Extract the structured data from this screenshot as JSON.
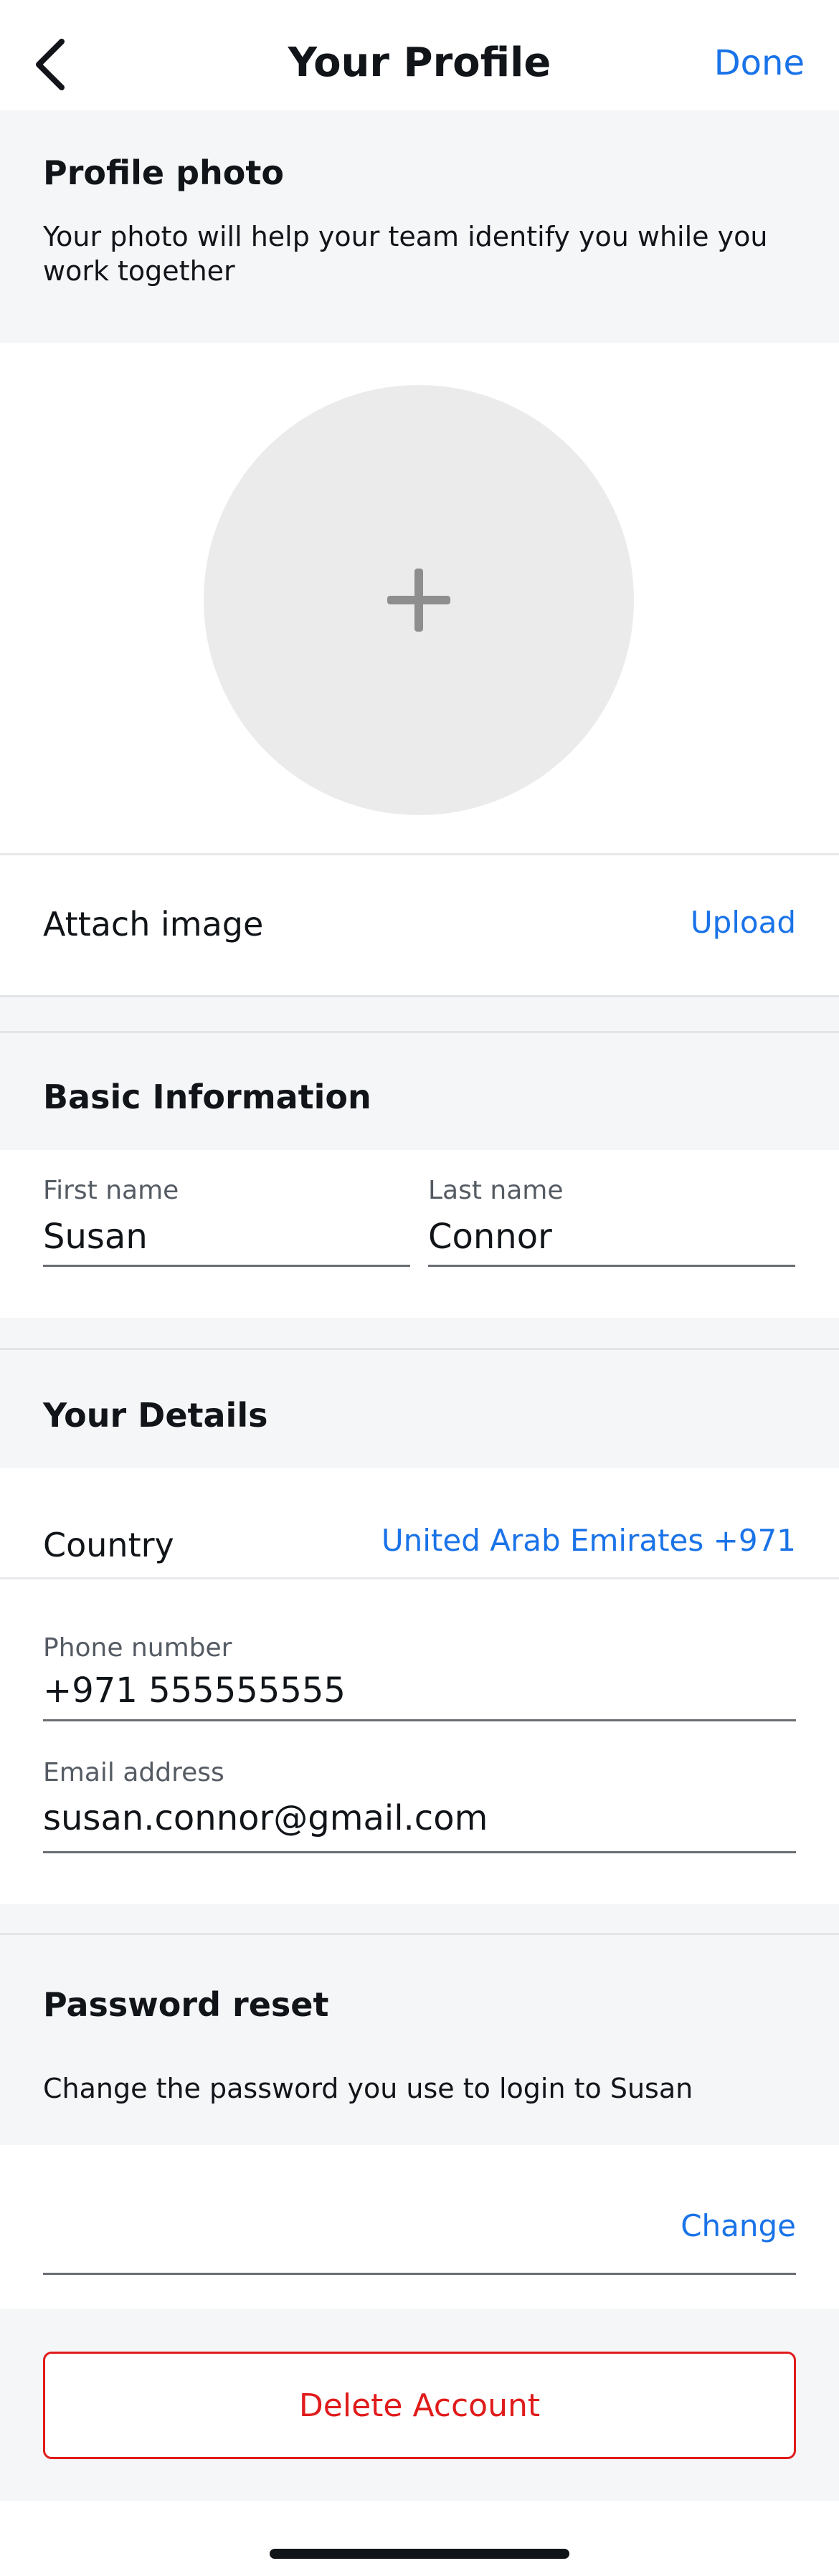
{
  "nav": {
    "title": "Your Profile",
    "done_label": "Done",
    "back_icon": "chevron-left-icon"
  },
  "profile_photo": {
    "heading": "Profile photo",
    "description": "Your photo will help your team identify you while you work together",
    "add_icon": "plus-icon",
    "attach_label": "Attach image",
    "upload_label": "Upload"
  },
  "basic_info": {
    "heading": "Basic Information",
    "first_name_label": "First name",
    "first_name_value": "Susan",
    "last_name_label": "Last name",
    "last_name_value": "Connor"
  },
  "details": {
    "heading": "Your Details",
    "country_label": "Country",
    "country_value": "United Arab Emirates +971",
    "phone_label": "Phone number",
    "phone_value": "+971 555555555",
    "email_label": "Email address",
    "email_value": "susan.connor@gmail.com"
  },
  "password": {
    "heading": "Password reset",
    "description": "Change the password you use to login to Susan",
    "change_label": "Change"
  },
  "delete_label": "Delete Account",
  "colors": {
    "accent": "#1a73e8",
    "danger": "#e01b1b",
    "section_bg": "#f5f6f8"
  }
}
